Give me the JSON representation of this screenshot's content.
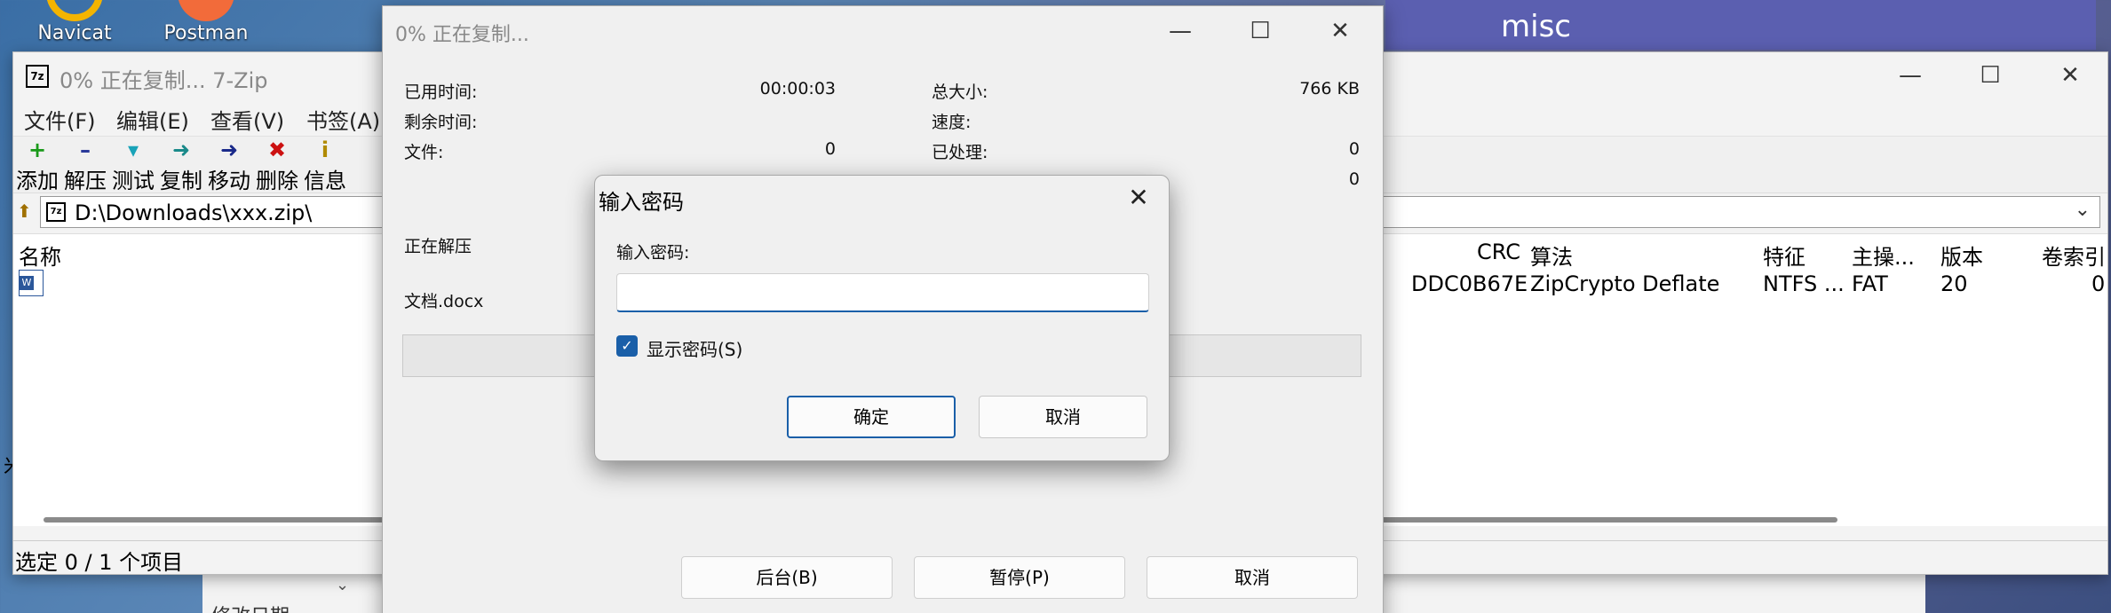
{
  "desktop": {
    "icons": [
      {
        "label": "Navicat"
      },
      {
        "label": "Postman"
      }
    ],
    "bg_window_title": "misc"
  },
  "explorer_bg": {
    "column_fragment": "修改日期",
    "left_fragment": "米"
  },
  "zip_window": {
    "title": "0% 正在复制... 7-Zip",
    "menu": [
      "文件(F)",
      "编辑(E)",
      "查看(V)",
      "书签(A)"
    ],
    "toolbar": [
      {
        "label": "添加",
        "icon": "add-icon",
        "glyph": "+",
        "color": "#1a9a1a"
      },
      {
        "label": "解压",
        "icon": "extract-icon",
        "glyph": "–",
        "color": "#2a3a9a"
      },
      {
        "label": "测试",
        "icon": "test-icon",
        "glyph": "▾",
        "color": "#19a3b8"
      },
      {
        "label": "复制",
        "icon": "copy-icon",
        "glyph": "➜",
        "color": "#1a8a8a"
      },
      {
        "label": "移动",
        "icon": "move-icon",
        "glyph": "➜",
        "color": "#1a2a8a"
      },
      {
        "label": "删除",
        "icon": "delete-icon",
        "glyph": "✖",
        "color": "#cc1111"
      },
      {
        "label": "信息",
        "icon": "info-icon",
        "glyph": "i",
        "color": "#b08a00"
      }
    ],
    "address": "D:\\Downloads\\xxx.zip\\",
    "columns": {
      "name": "名称",
      "crc": "CRC",
      "method": "算法",
      "characteristics": "特征",
      "host_os": "主操...",
      "version": "版本",
      "volume_index": "卷索引"
    },
    "row": {
      "crc": "DDC0B67E",
      "method": "ZipCrypto Deflate",
      "characteristics": "NTFS ...",
      "host_os": "FAT",
      "version": "20",
      "volume_index": "0"
    },
    "status": "选定 0 / 1 个项目"
  },
  "progress_dialog": {
    "title": "0% 正在复制...",
    "elapsed_label": "已用时间:",
    "elapsed_value": "00:00:03",
    "remaining_label": "剩余时间:",
    "files_label": "文件:",
    "files_value": "0",
    "total_size_label": "总大小:",
    "total_size_value": "766 KB",
    "speed_label": "速度:",
    "processed_label": "已处理:",
    "processed_value": "0",
    "compressed_value": "0",
    "operation": "正在解压",
    "current_file": "文档.docx",
    "progress_fraction": 0.0,
    "buttons": {
      "background": "后台(B)",
      "pause": "暂停(P)",
      "cancel": "取消"
    }
  },
  "password_dialog": {
    "title": "输入密码",
    "prompt": "输入密码:",
    "value": "",
    "show_password_label": "显示密码(S)",
    "show_password_checked": true,
    "ok": "确定",
    "cancel": "取消",
    "accent": "#1a5fa8"
  }
}
